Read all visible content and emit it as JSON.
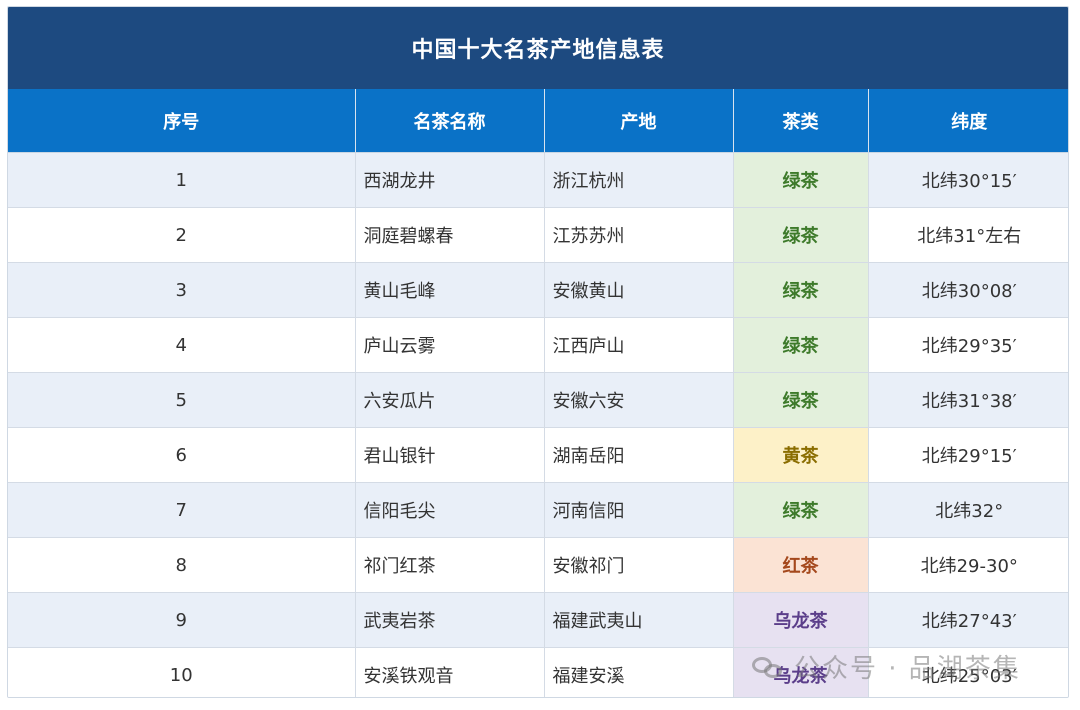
{
  "title": "中国十大名茶产地信息表",
  "headers": {
    "index": "序号",
    "name": "名茶名称",
    "origin": "产地",
    "type": "茶类",
    "latitude": "纬度"
  },
  "rows": [
    {
      "index": "1",
      "name": "西湖龙井",
      "origin": "浙江杭州",
      "type": "绿茶",
      "latitude": "北纬30°15′"
    },
    {
      "index": "2",
      "name": "洞庭碧螺春",
      "origin": "江苏苏州",
      "type": "绿茶",
      "latitude": "北纬31°左右"
    },
    {
      "index": "3",
      "name": "黄山毛峰",
      "origin": "安徽黄山",
      "type": "绿茶",
      "latitude": "北纬30°08′"
    },
    {
      "index": "4",
      "name": "庐山云雾",
      "origin": "江西庐山",
      "type": "绿茶",
      "latitude": "北纬29°35′"
    },
    {
      "index": "5",
      "name": "六安瓜片",
      "origin": "安徽六安",
      "type": "绿茶",
      "latitude": "北纬31°38′"
    },
    {
      "index": "6",
      "name": "君山银针",
      "origin": "湖南岳阳",
      "type": "黄茶",
      "latitude": "北纬29°15′"
    },
    {
      "index": "7",
      "name": "信阳毛尖",
      "origin": "河南信阳",
      "type": "绿茶",
      "latitude": "北纬32°"
    },
    {
      "index": "8",
      "name": "祁门红茶",
      "origin": "安徽祁门",
      "type": "红茶",
      "latitude": "北纬29-30°"
    },
    {
      "index": "9",
      "name": "武夷岩茶",
      "origin": "福建武夷山",
      "type": "乌龙茶",
      "latitude": "北纬27°43′"
    },
    {
      "index": "10",
      "name": "安溪铁观音",
      "origin": "福建安溪",
      "type": "乌龙茶",
      "latitude": "北纬25°03′"
    }
  ],
  "type_colors": {
    "绿茶": "#3d7a2a",
    "黄茶": "#8a6d00",
    "红茶": "#a4481c",
    "乌龙茶": "#5b3e8a"
  },
  "colors": {
    "title_bg": "#1d4a80",
    "header_bg": "#0a72c7",
    "row_alt_bg": "#e9eff8"
  },
  "watermark": {
    "icon": "wechat-icon",
    "text": "公众号 · 品湖茶集"
  }
}
